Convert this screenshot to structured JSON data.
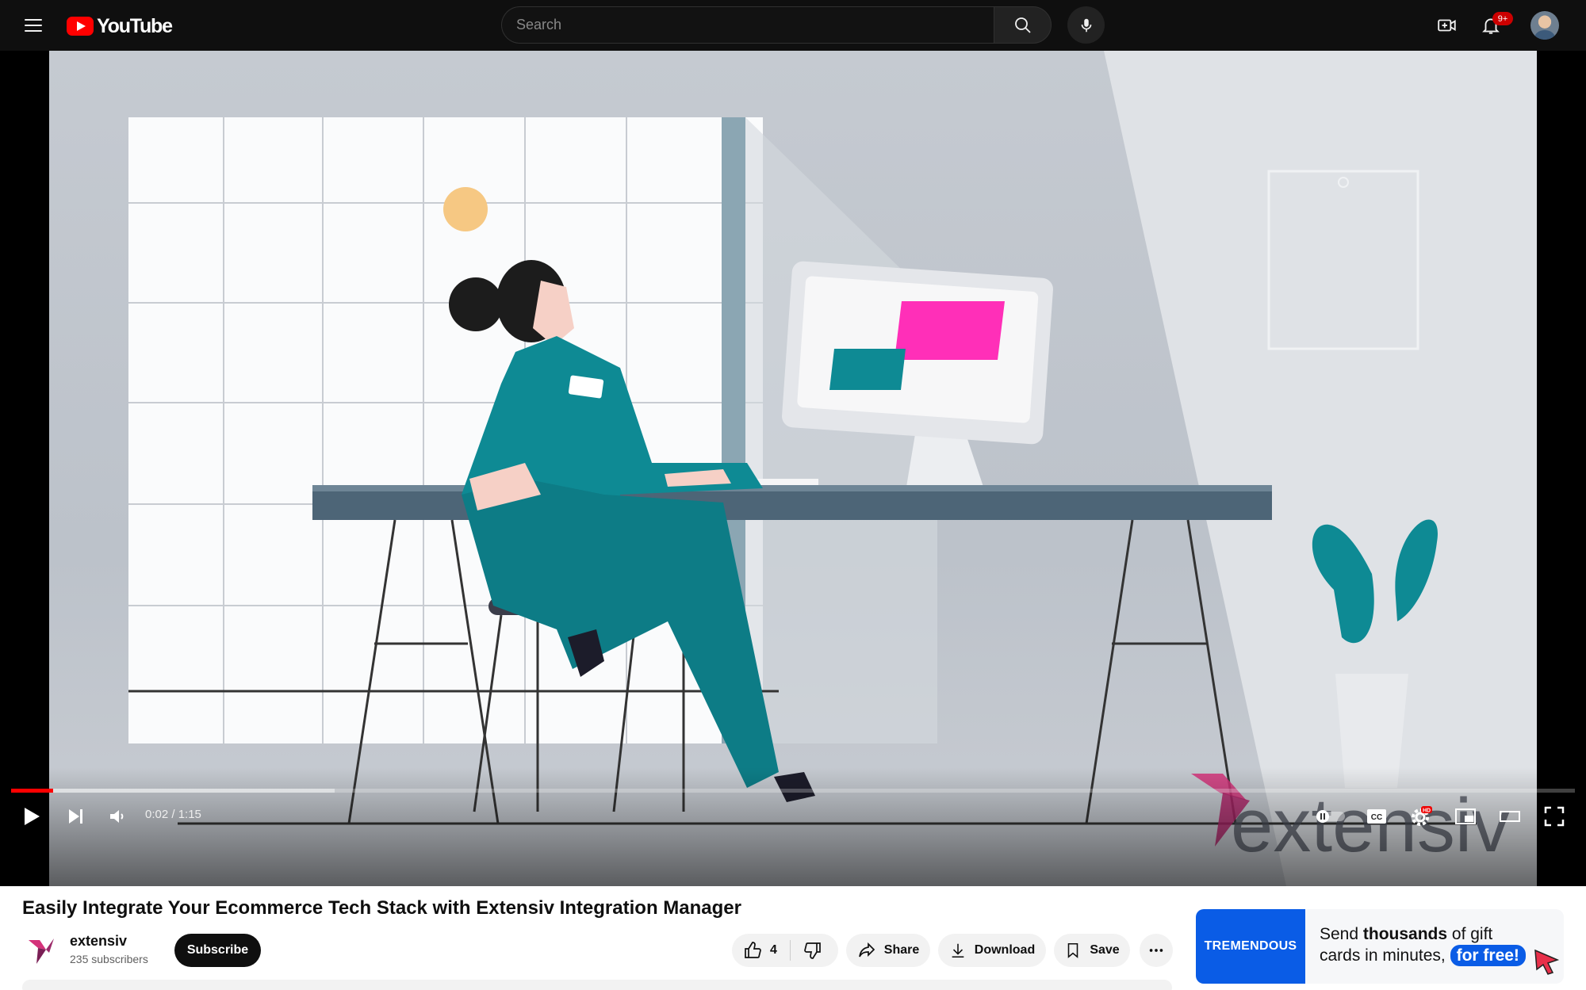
{
  "header": {
    "logo_text": "YouTube",
    "search_placeholder": "Search",
    "notification_count": "9+"
  },
  "player": {
    "time_current": "0:02",
    "time_duration": "1:15",
    "time_display": "0:02 / 1:15",
    "progress_fraction": 0.027,
    "buffered_fraction": 0.207,
    "watermark_text": "extensiv",
    "settings_badge": "HD",
    "cc_label": "CC"
  },
  "video": {
    "title": "Easily Integrate Your Ecommerce Tech Stack with Extensiv Integration Manager"
  },
  "channel": {
    "name": "extensiv",
    "subscribers": "235 subscribers",
    "subscribe_label": "Subscribe"
  },
  "actions": {
    "like_count": "4",
    "share_label": "Share",
    "download_label": "Download",
    "save_label": "Save"
  },
  "ad": {
    "brand": "TREMENDOUS",
    "line1_prefix": "Send ",
    "line1_bold": "thousands",
    "line1_suffix": " of gift",
    "line2": "cards in minutes, ",
    "cta": "for free!"
  },
  "colors": {
    "brand_red": "#ff0000",
    "teal": "#0e8a94",
    "magenta": "#ff2fb8",
    "ad_blue": "#0a5ce6"
  }
}
